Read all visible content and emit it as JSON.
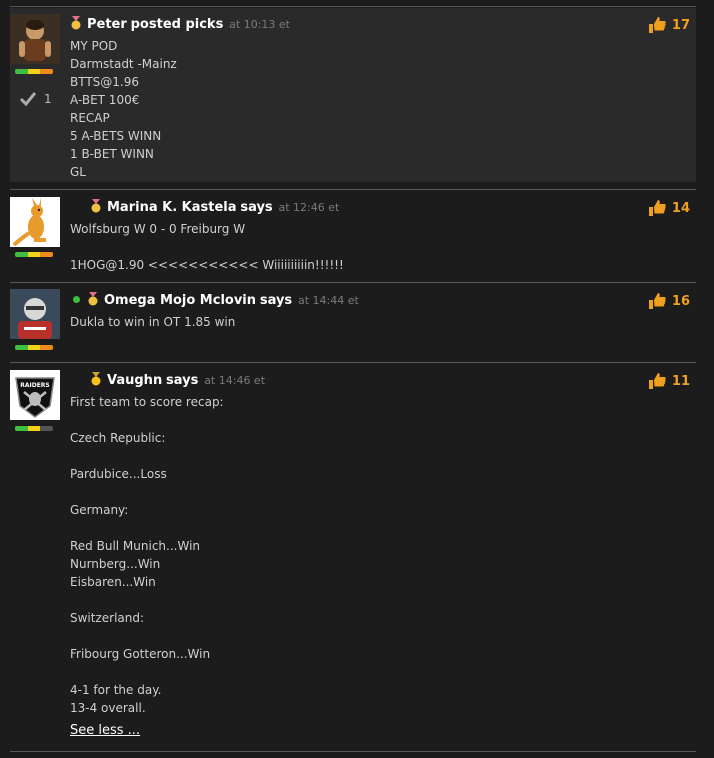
{
  "colors": {
    "accent": "#f0a020",
    "background": "#1c1c1c",
    "highlight": "#2a2a2a"
  },
  "posts": [
    {
      "author": "Peter",
      "verb": "posted picks",
      "time": "at 10:13 et",
      "likes": "17",
      "checks": "1",
      "medal": "pink-medal-icon",
      "lines": [
        "MY POD",
        "Darmstadt -Mainz",
        "BTTS@1.96",
        "A-BET 100€",
        "RECAP",
        "5 A-BETS WINN",
        "1 B-BET WINN",
        "GL"
      ]
    },
    {
      "author": "Marina K. Kastela",
      "verb": "says",
      "time": "at 12:46 et",
      "likes": "14",
      "medal": "pink-medal-icon",
      "lines": [
        "Wolfsburg W 0 - 0 Freiburg W",
        "",
        "1HOG@1.90 <<<<<<<<<<< Wiiiiiiiiiin!!!!!!"
      ]
    },
    {
      "author": "Omega Mojo Mclovin",
      "verb": "says",
      "time": "at 14:44 et",
      "likes": "16",
      "medal": "pink-medal-icon",
      "online": true,
      "lines": [
        "Dukla to win in OT 1.85 win"
      ]
    },
    {
      "author": "Vaughn",
      "verb": "says",
      "time": "at 14:46 et",
      "likes": "11",
      "medal": "gold-medal-icon",
      "lines": [
        "First team to score recap:",
        "",
        "Czech Republic:",
        "",
        "Pardubice...Loss",
        "",
        "Germany:",
        "",
        "Red Bull Munich...Win",
        "Nurnberg...Win",
        "Eisbaren...Win",
        "",
        "Switzerland:",
        "",
        "Fribourg Gotteron...Win",
        "",
        "4-1 for the day.",
        "13-4 overall."
      ],
      "see_less": "See less ..."
    }
  ]
}
